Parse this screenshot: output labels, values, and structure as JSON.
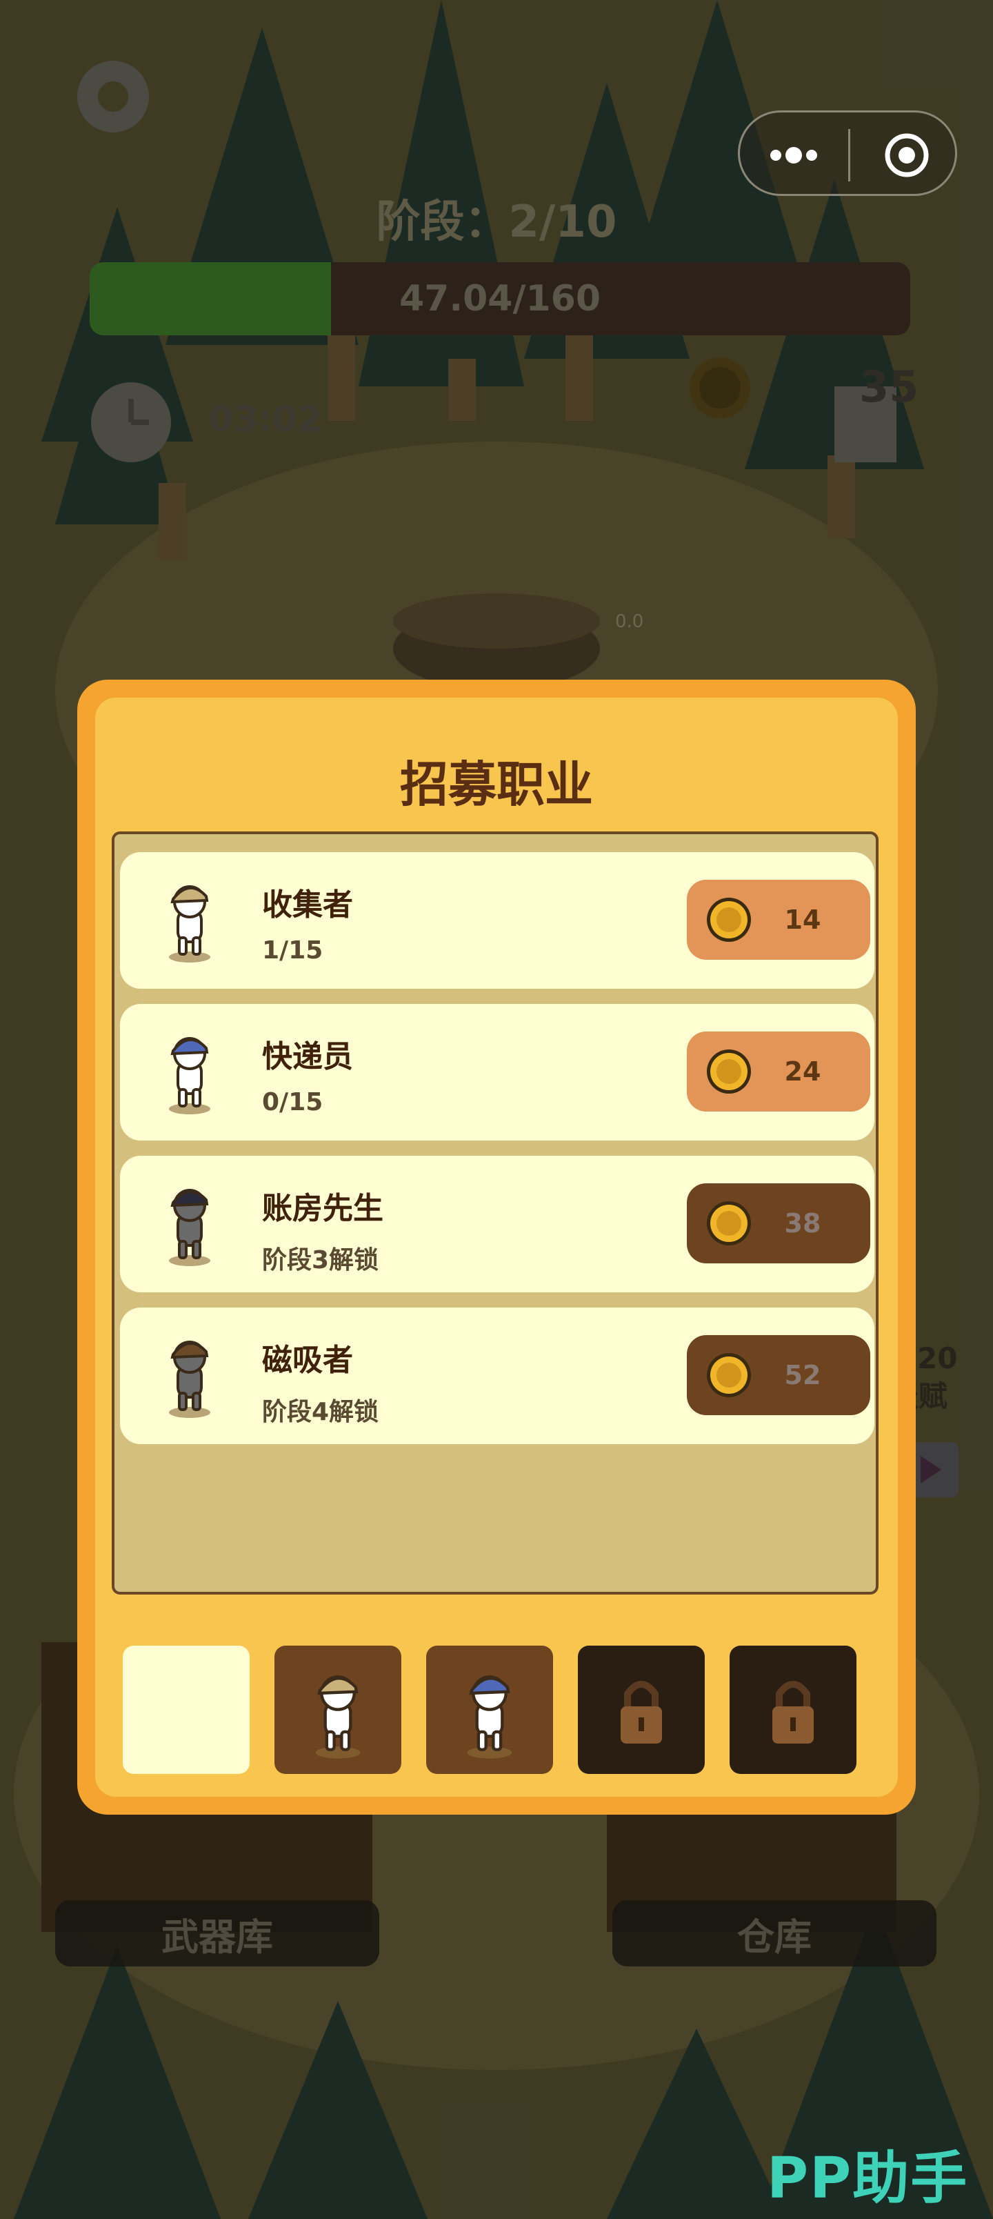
{
  "hud": {
    "stage_label": "阶段：2/10",
    "progress_text": "47.04/160",
    "progress_fraction": 0.294,
    "timer": "03:02",
    "coin_count": "35"
  },
  "menu_capsule": {
    "more_icon": "more-dots-icon",
    "close_icon": "target-circle-icon"
  },
  "buildings": {
    "armory_label": "武器库",
    "warehouse_label": "仓库"
  },
  "side_label": {
    "top": "20",
    "bottom": "天赋"
  },
  "scene_marker": "0.0",
  "watermark": "PP助手",
  "dialog": {
    "title": "招募职业",
    "professions": [
      {
        "name": "收集者",
        "status": "1/15",
        "cost": "14",
        "locked": false,
        "hat": "#c9b27a",
        "body": "#ffffff"
      },
      {
        "name": "快递员",
        "status": "0/15",
        "cost": "24",
        "locked": false,
        "hat": "#5068b8",
        "body": "#ffffff"
      },
      {
        "name": "账房先生",
        "status": "阶段3解锁",
        "cost": "38",
        "locked": true,
        "hat": "#2a2a3a",
        "body": "#6a6a6a"
      },
      {
        "name": "磁吸者",
        "status": "阶段4解锁",
        "cost": "52",
        "locked": true,
        "hat": "#6a4a28",
        "body": "#6a6a6a"
      }
    ],
    "tabs": [
      {
        "state": "selected"
      },
      {
        "state": "unlocked",
        "hat": "#c9b27a"
      },
      {
        "state": "unlocked",
        "hat": "#5068b8"
      },
      {
        "state": "locked",
        "icon": "padlock-icon"
      },
      {
        "state": "locked",
        "icon": "padlock-icon"
      }
    ]
  },
  "colors": {
    "panel_border": "#f5a430",
    "panel_bg": "#f8c64e",
    "active_button": "#e29556",
    "locked_button": "#6e4420",
    "watermark": "#3ed3b8"
  }
}
